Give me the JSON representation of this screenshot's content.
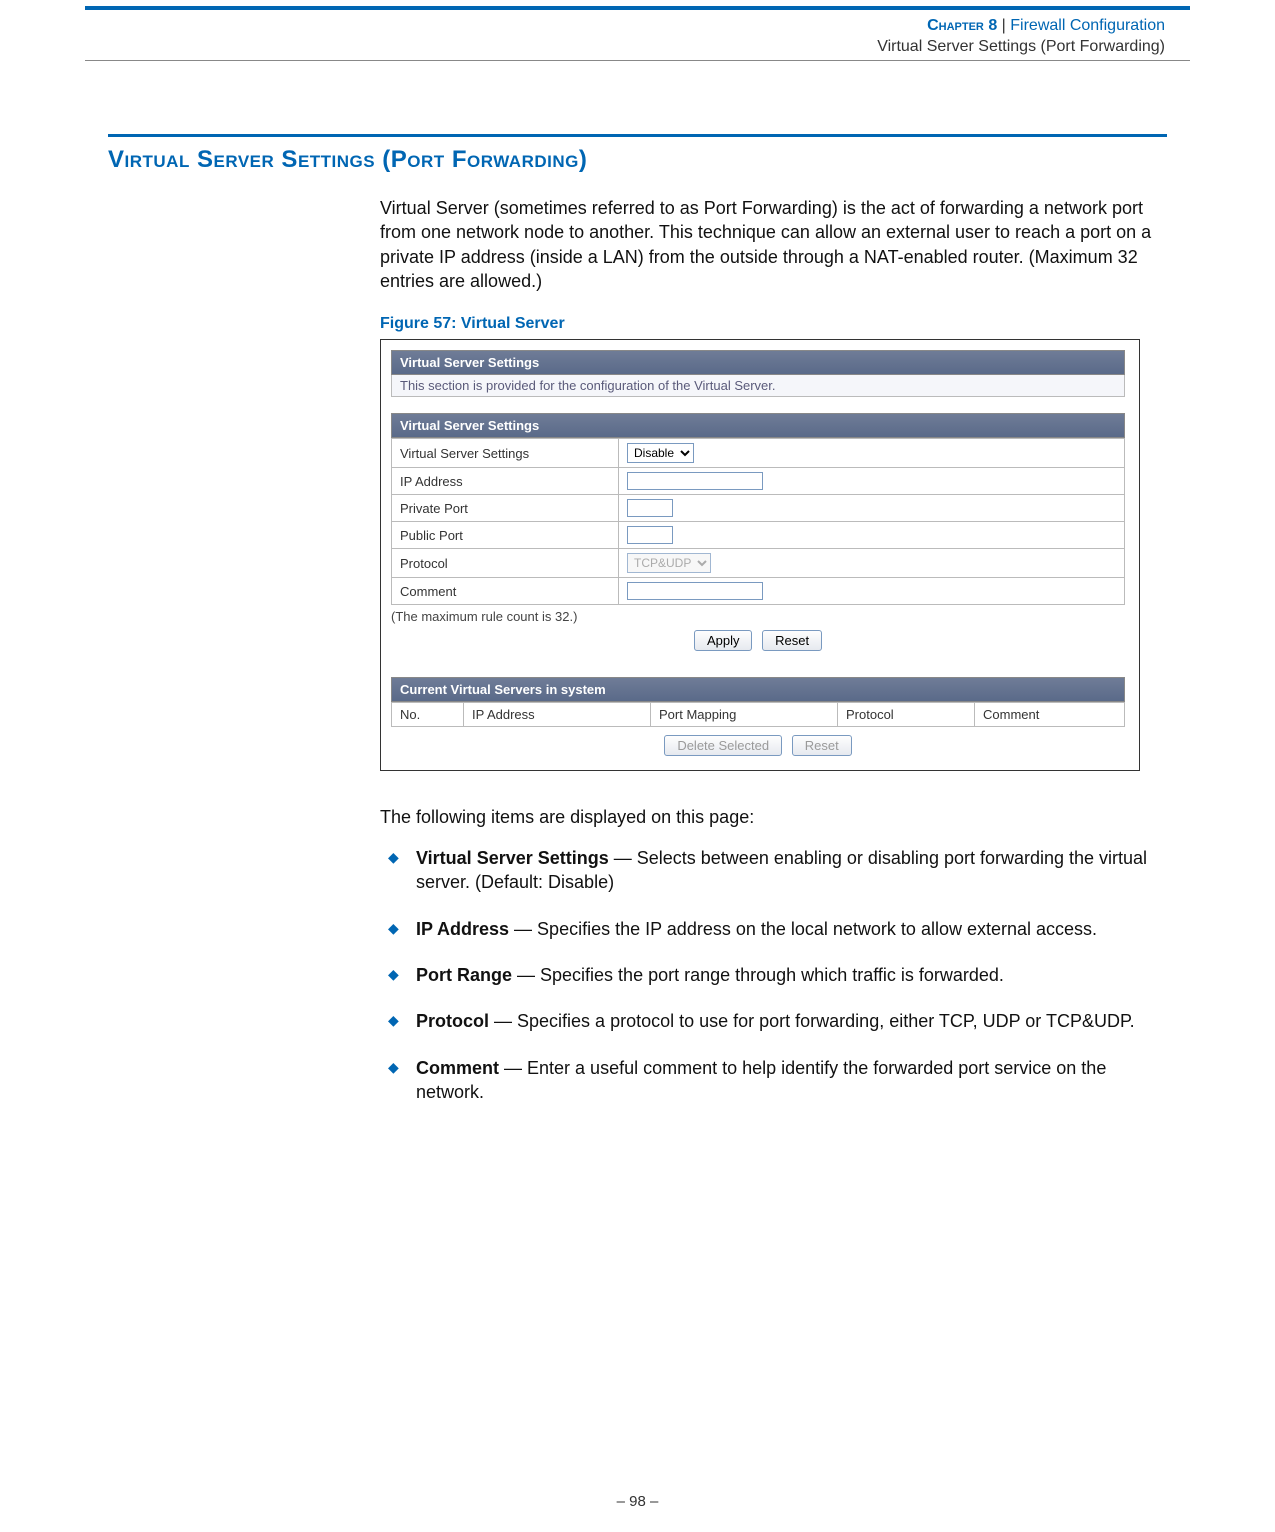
{
  "header": {
    "chapter_label": "Chapter 8",
    "separator": "  |  ",
    "title": "Firewall Configuration",
    "subtitle": "Virtual Server Settings (Port Forwarding)"
  },
  "section_title": "Virtual Server Settings (Port Forwarding)",
  "intro": "Virtual Server (sometimes referred to as Port Forwarding) is the act of forwarding a network port from one network node to another. This technique can allow an external user to reach a port on a private IP address (inside a LAN) from the outside through a NAT-enabled router. (Maximum 32 entries are allowed.)",
  "figure_caption": "Figure 57:  Virtual Server",
  "figure": {
    "title_bar": "Virtual Server Settings",
    "note": "This section is provided for the configuration of the Virtual Server.",
    "form_header": "Virtual Server Settings",
    "rows": {
      "vss_label": "Virtual Server Settings",
      "vss_value": "Disable",
      "ip_label": "IP Address",
      "privport_label": "Private Port",
      "pubport_label": "Public Port",
      "protocol_label": "Protocol",
      "protocol_value": "TCP&UDP",
      "comment_label": "Comment"
    },
    "max_note": "(The maximum rule count is 32.)",
    "apply_btn": "Apply",
    "reset_btn": "Reset",
    "current_header": "Current Virtual Servers in system",
    "cols": {
      "no": "No.",
      "ip": "IP Address",
      "pm": "Port Mapping",
      "proto": "Protocol",
      "comment": "Comment"
    },
    "delete_btn": "Delete Selected",
    "reset2_btn": "Reset"
  },
  "following_intro": "The following items are displayed on this page:",
  "items": [
    {
      "term": "Virtual Server Settings",
      "desc": " — Selects between enabling or disabling port forwarding the virtual server. (Default: Disable)"
    },
    {
      "term": "IP Address",
      "desc": " — Specifies the IP address on the local network to allow external access."
    },
    {
      "term": "Port Range",
      "desc": " — Specifies the port range through which traffic is forwarded."
    },
    {
      "term": "Protocol",
      "desc": " — Specifies a protocol to use for port forwarding, either TCP, UDP or TCP&UDP."
    },
    {
      "term": "Comment",
      "desc": " — Enter a useful comment to help identify the forwarded port service on the network."
    }
  ],
  "page_number": "–  98  –"
}
